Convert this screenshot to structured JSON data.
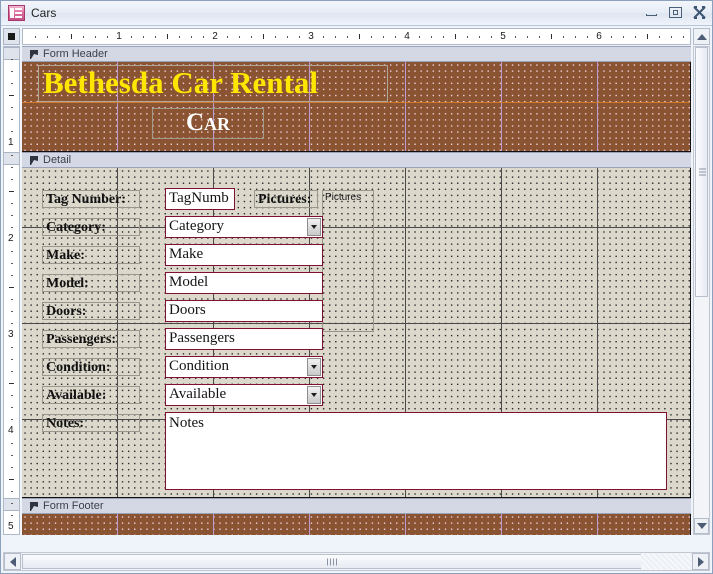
{
  "window": {
    "title": "Cars",
    "icon": "form-design-icon",
    "buttons": {
      "minimize": "Minimize",
      "restore": "Restore",
      "close": "Close"
    }
  },
  "rulers": {
    "horizontal_numbers": [
      "1",
      "2",
      "3",
      "4",
      "5",
      "6"
    ],
    "vertical_numbers": [
      "1",
      "2",
      "3"
    ],
    "unit": "inches"
  },
  "sections": [
    {
      "id": "form-header",
      "label": "Form Header"
    },
    {
      "id": "detail",
      "label": "Detail"
    },
    {
      "id": "form-footer",
      "label": "Form Footer"
    }
  ],
  "header_controls": {
    "title": "Bethesda Car Rental",
    "subtitle": "Car"
  },
  "detail_controls": [
    {
      "label": "Tag Number:",
      "value": "TagNumb",
      "type": "textbox"
    },
    {
      "label": "Category:",
      "value": "Category",
      "type": "combobox"
    },
    {
      "label": "Make:",
      "value": "Make",
      "type": "textbox"
    },
    {
      "label": "Model:",
      "value": "Model",
      "type": "textbox"
    },
    {
      "label": "Doors:",
      "value": "Doors",
      "type": "textbox"
    },
    {
      "label": "Passengers:",
      "value": "Passengers",
      "type": "textbox"
    },
    {
      "label": "Condition:",
      "value": "Condition",
      "type": "combobox"
    },
    {
      "label": "Available:",
      "value": "Available",
      "type": "combobox"
    },
    {
      "label": "Notes:",
      "value": "Notes",
      "type": "memo"
    }
  ],
  "pictures_control": {
    "label": "Pictures:",
    "value": "Pictures",
    "type": "bound-object-frame"
  },
  "colors": {
    "header_background": "#8a5432",
    "header_grid_dots": "#f0ccd9",
    "header_gridline_vertical": "#b99ad6",
    "header_gridline_horizontal": "#d07a2e",
    "detail_background": "#dcd8cc",
    "detail_grid_dots": "#2a2a2a",
    "title_text": "#ffe600",
    "subtitle_text": "#ffffff",
    "control_border": "#7e1130",
    "section_bar": "#d4d8e4"
  }
}
